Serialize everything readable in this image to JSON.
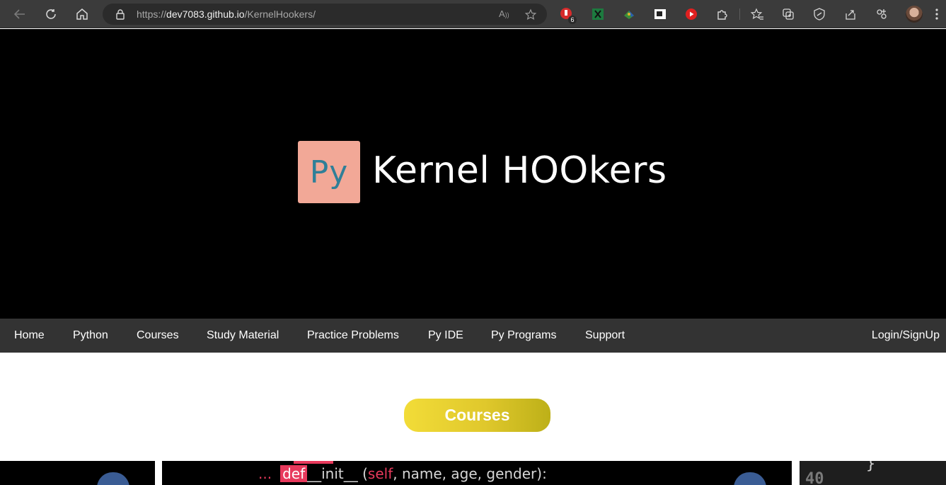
{
  "browser": {
    "url_prefix": "https://",
    "url_host": "dev7083.github.io",
    "url_path": "/KernelHookers/",
    "extension_badge": "6",
    "read_aloud_glyph": "A",
    "icons": [
      "back-icon",
      "refresh-icon",
      "home-icon",
      "lock-icon",
      "read-aloud-icon",
      "add-favorite-icon",
      "extension-icons",
      "puzzle-icon",
      "favorites-icon",
      "collections-icon",
      "browser-essentials-icon",
      "share-icon",
      "profile-icon"
    ]
  },
  "hero": {
    "logo_text": "Py",
    "title": "Kernel HOOkers"
  },
  "nav": {
    "items": [
      "Home",
      "Python",
      "Courses",
      "Study Material",
      "Practice Problems",
      "Py IDE",
      "Py Programs",
      "Support"
    ],
    "login": "Login/SignUp"
  },
  "section": {
    "courses_label": "Courses"
  },
  "cards": {
    "code_dots": "...",
    "code_def": "def",
    "code_init": "__init__ (",
    "code_self": "self",
    "code_args": ", name, age, gender):",
    "line_number": "40",
    "brace": "}"
  },
  "colors": {
    "hero_bg": "#000000",
    "logo_bg": "#f2a897",
    "logo_text": "#2f7f98",
    "nav_bg": "#333333",
    "pill_gradient_start": "#f2dc38",
    "pill_gradient_end": "#bdb018",
    "code_accent": "#e8395c"
  }
}
